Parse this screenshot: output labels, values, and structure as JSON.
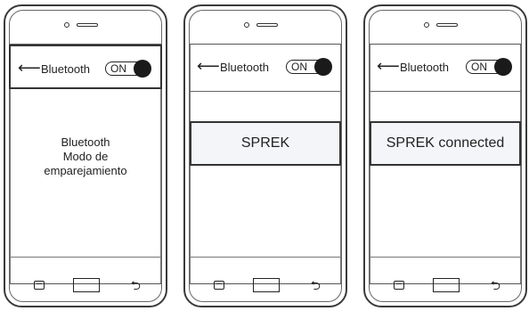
{
  "phones": [
    {
      "header": {
        "back_glyph": "⟵",
        "title": "Bluetooth",
        "toggle_label": "ON",
        "highlighted": true
      },
      "content_lines": [
        "Bluetooth",
        "Modo de",
        "emparejamiento"
      ],
      "device_box": ""
    },
    {
      "header": {
        "back_glyph": "⟵",
        "title": "Bluetooth",
        "toggle_label": "ON",
        "highlighted": false
      },
      "content_lines": [],
      "device_box": "SPREK"
    },
    {
      "header": {
        "back_glyph": "⟵",
        "title": "Bluetooth",
        "toggle_label": "ON",
        "highlighted": false
      },
      "content_lines": [],
      "device_box": "SPREK connected"
    }
  ],
  "navbar": {
    "back_glyph": "⮌"
  },
  "icons": {
    "back": "arrow-left-icon",
    "toggle": "toggle-switch-icon",
    "menu": "menu-icon",
    "home": "home-button-icon",
    "nav_back": "return-icon"
  }
}
